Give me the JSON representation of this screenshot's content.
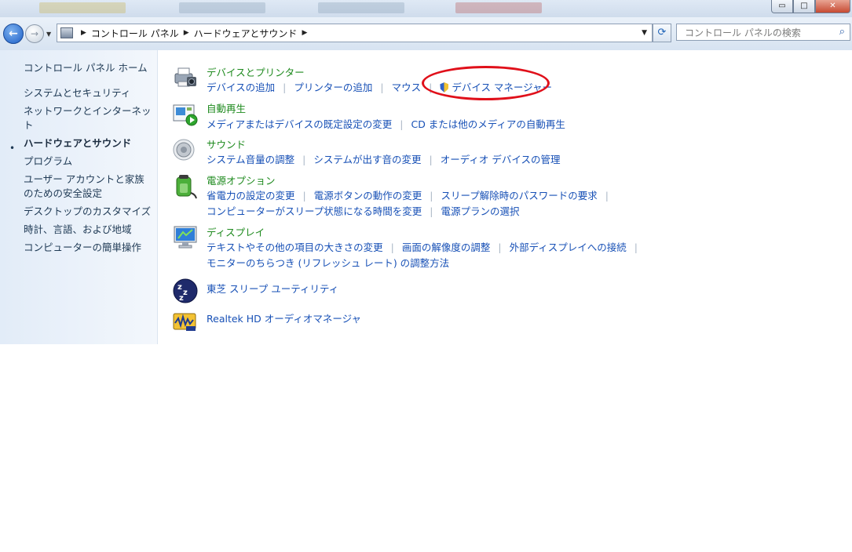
{
  "colors": {
    "accent_link": "#1750b6",
    "category_title": "#1e8a1e",
    "annotation": "#e0101a"
  },
  "window": {
    "min_glyph": "▭",
    "max_glyph": "□",
    "close_glyph": "✕"
  },
  "navbar": {
    "back_glyph": "←",
    "forward_glyph": "→",
    "breadcrumbs": [
      "コントロール パネル",
      "ハードウェアとサウンド"
    ],
    "refresh_glyph": "⟳",
    "search_placeholder": "コントロール パネルの検索",
    "search_glyph": "⌕"
  },
  "sidebar": {
    "home": "コントロール パネル ホーム",
    "items": [
      "システムとセキュリティ",
      "ネットワークとインターネット",
      "ハードウェアとサウンド",
      "プログラム",
      "ユーザー アカウントと家族のための安全設定",
      "デスクトップのカスタマイズ",
      "時計、言語、および地域",
      "コンピューターの簡単操作"
    ],
    "current_index": 2,
    "bullet": "•"
  },
  "categories": {
    "devices": {
      "title": "デバイスとプリンター",
      "links": [
        "デバイスの追加",
        "プリンターの追加",
        "マウス",
        "デバイス マネージャー"
      ]
    },
    "autoplay": {
      "title": "自動再生",
      "links": [
        "メディアまたはデバイスの既定設定の変更",
        "CD または他のメディアの自動再生"
      ]
    },
    "sound": {
      "title": "サウンド",
      "links": [
        "システム音量の調整",
        "システムが出す音の変更",
        "オーディオ デバイスの管理"
      ]
    },
    "power": {
      "title": "電源オプション",
      "links": [
        "省電力の設定の変更",
        "電源ボタンの動作の変更",
        "スリープ解除時のパスワードの要求",
        "コンピューターがスリープ状態になる時間を変更",
        "電源プランの選択"
      ]
    },
    "display": {
      "title": "ディスプレイ",
      "links": [
        "テキストやその他の項目の大きさの変更",
        "画面の解像度の調整",
        "外部ディスプレイへの接続",
        "モニターのちらつき (リフレッシュ レート) の調整方法"
      ]
    },
    "toshiba": {
      "title": "東芝 スリープ ユーティリティ"
    },
    "realtek": {
      "title": "Realtek HD オーディオマネージャ"
    }
  }
}
